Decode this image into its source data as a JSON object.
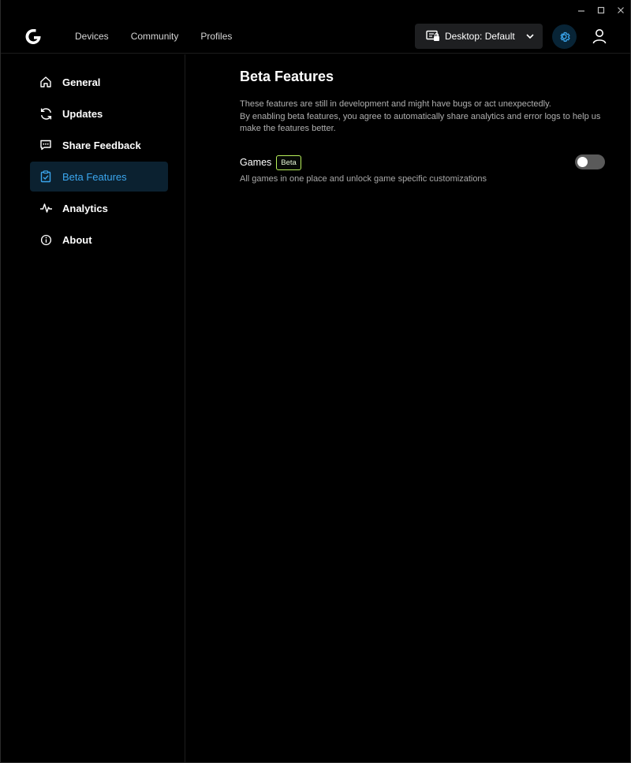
{
  "topnav": {
    "items": [
      {
        "label": "Devices"
      },
      {
        "label": "Community"
      },
      {
        "label": "Profiles"
      }
    ],
    "profile_select": {
      "label": "Desktop: Default"
    }
  },
  "sidebar": {
    "items": [
      {
        "label": "General",
        "icon": "home-icon"
      },
      {
        "label": "Updates",
        "icon": "refresh-icon"
      },
      {
        "label": "Share Feedback",
        "icon": "feedback-icon"
      },
      {
        "label": "Beta Features",
        "icon": "clipboard-check-icon",
        "active": true
      },
      {
        "label": "Analytics",
        "icon": "pulse-icon"
      },
      {
        "label": "About",
        "icon": "info-icon"
      }
    ]
  },
  "main": {
    "title": "Beta Features",
    "description_line1": "These features are still in development and might have bugs or act unexpectedly.",
    "description_line2": "By enabling beta features, you agree to automatically share analytics and error logs to help us make the features better.",
    "features": [
      {
        "name": "Games",
        "badge": "Beta",
        "description": "All games in one place and unlock game specific customizations",
        "enabled": false
      }
    ]
  },
  "colors": {
    "accent": "#3ba6ee",
    "active_bg": "#0b2130",
    "badge_border": "#b8f05a"
  }
}
